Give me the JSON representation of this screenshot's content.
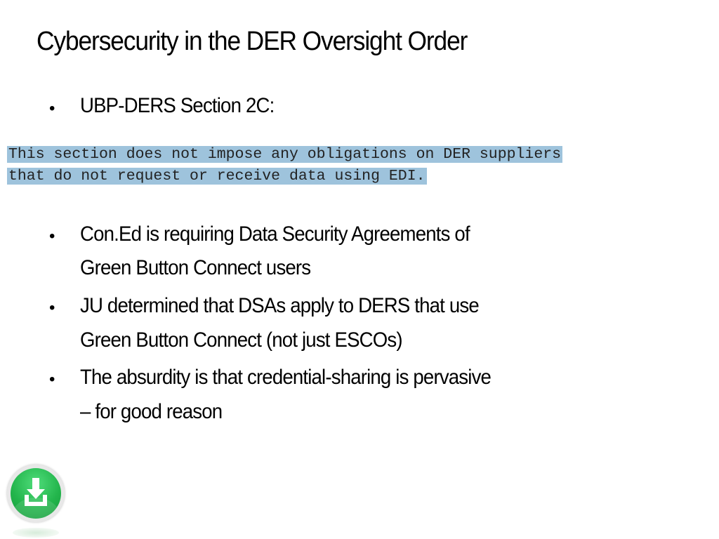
{
  "slide": {
    "title": "Cybersecurity in the DER Oversight Order",
    "section_bullet": "UBP-DERS Section 2C:",
    "quote_lines": [
      "This section does not impose any obligations on DER suppliers",
      "that do not request or receive data using EDI."
    ],
    "bullets": [
      {
        "lines": [
          "Con.Ed is requiring Data Security Agreements of",
          "Green Button Connect users"
        ]
      },
      {
        "lines": [
          "JU determined that DSAs apply to DERS that use",
          "Green Button Connect (not just ESCOs)"
        ]
      },
      {
        "lines": [
          "The absurdity is that credential-sharing is pervasive",
          "– for good reason"
        ]
      }
    ],
    "bullet_glyph": "•"
  },
  "download_button": {
    "icon": "download-icon",
    "color": "#23b54c"
  },
  "colors": {
    "quote_highlight": "#9ec3dc"
  }
}
